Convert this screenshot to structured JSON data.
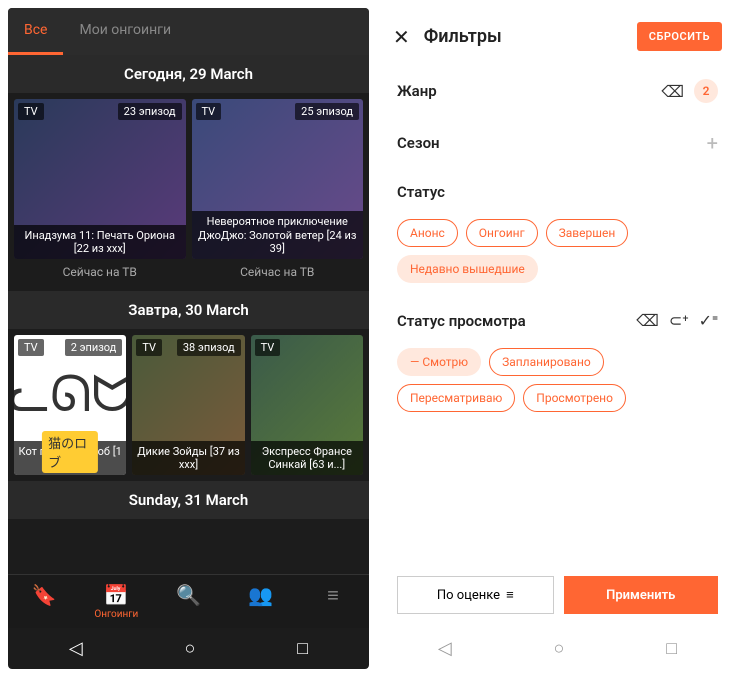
{
  "left": {
    "tabs": {
      "all": "Все",
      "my": "Мои онгоинги"
    },
    "s1": {
      "header": "Сегодня, 29 March",
      "c0": {
        "tv": "TV",
        "ep": "23 эпизод",
        "title": "Инадзума 11: Печать Ориона [22 из xxx]",
        "onair": "Сейчас на ТВ"
      },
      "c1": {
        "tv": "TV",
        "ep": "25 эпизод",
        "title": "Невероятное приключение ДжоДжо: Золотой ветер [24 из 39]",
        "onair": "Сейчас на ТВ"
      }
    },
    "s2": {
      "header": "Завтра, 30 March",
      "c0": {
        "tv": "TV",
        "ep": "2 эпизод",
        "title": "Кот по имени Роб [1 из xxx]",
        "jp": "猫のロブ"
      },
      "c1": {
        "tv": "TV",
        "ep": "38 эпизод",
        "title": "Дикие Зойды [37 из xxx]"
      },
      "c2": {
        "tv": "TV",
        "title": "Экспресс Франсе Синкай [63 и...]"
      }
    },
    "s3": {
      "header": "Sunday, 31 March"
    },
    "nav": {
      "ongoing": "Онгоинги"
    }
  },
  "right": {
    "title": "Фильтры",
    "reset": "СБРОСИТЬ",
    "genre": {
      "label": "Жанр",
      "count": "2"
    },
    "season": {
      "label": "Сезон"
    },
    "status": {
      "label": "Статус",
      "chips": {
        "c0": "Анонс",
        "c1": "Онгоинг",
        "c2": "Завершен",
        "c3": "Недавно вышедшие"
      }
    },
    "watch": {
      "label": "Статус просмотра",
      "chips": {
        "c0": "Смотрю",
        "c1": "Запланировано",
        "c2": "Пересматриваю",
        "c3": "Просмотрено"
      }
    },
    "sort": "По оценке",
    "apply": "Применить"
  }
}
